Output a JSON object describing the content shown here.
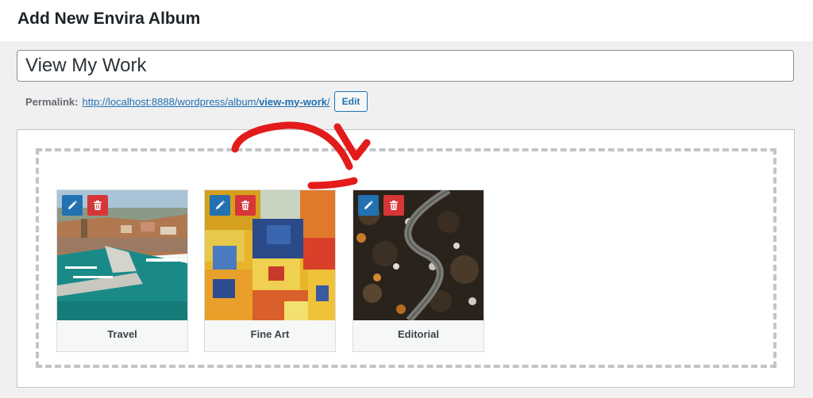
{
  "page": {
    "title": "Add New Envira Album"
  },
  "album": {
    "title_value": "View My Work"
  },
  "permalink": {
    "label": "Permalink:",
    "url_base": "http://localhost:8888/wordpress/album/",
    "url_slug": "view-my-work",
    "url_trailing": "/",
    "edit_label": "Edit"
  },
  "galleries": [
    {
      "label": "Travel"
    },
    {
      "label": "Fine Art"
    },
    {
      "label": "Editorial"
    }
  ],
  "icons": {
    "edit": "pencil-icon",
    "delete": "trash-icon"
  },
  "colors": {
    "link": "#2271b1",
    "edit_button": "#2271b1",
    "delete_button": "#d63638",
    "annotation_arrow": "#e31b1b"
  }
}
